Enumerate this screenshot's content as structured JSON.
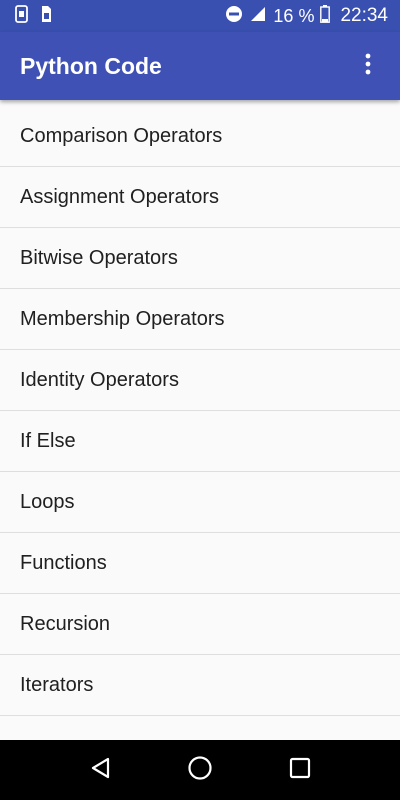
{
  "status_bar": {
    "battery_percent": "16 %",
    "time": "22:34",
    "icons": [
      "phone-notification-icon",
      "sim-icon",
      "do-not-disturb-icon",
      "signal-icon",
      "battery-icon"
    ]
  },
  "app_bar": {
    "title": "Python Code",
    "menu_icon": "more-vert-icon"
  },
  "list": {
    "items": [
      {
        "label": "Comparison Operators"
      },
      {
        "label": "Assignment Operators"
      },
      {
        "label": "Bitwise Operators"
      },
      {
        "label": "Membership Operators"
      },
      {
        "label": "Identity Operators"
      },
      {
        "label": "If Else"
      },
      {
        "label": "Loops"
      },
      {
        "label": "Functions"
      },
      {
        "label": "Recursion"
      },
      {
        "label": "Iterators"
      }
    ]
  },
  "nav_bar": {
    "icons": [
      "back-icon",
      "home-icon",
      "recents-icon"
    ]
  },
  "colors": {
    "primary": "#3f51b5",
    "status_bar": "#3a50b0",
    "background": "#fafafa",
    "divider": "#dedede"
  }
}
